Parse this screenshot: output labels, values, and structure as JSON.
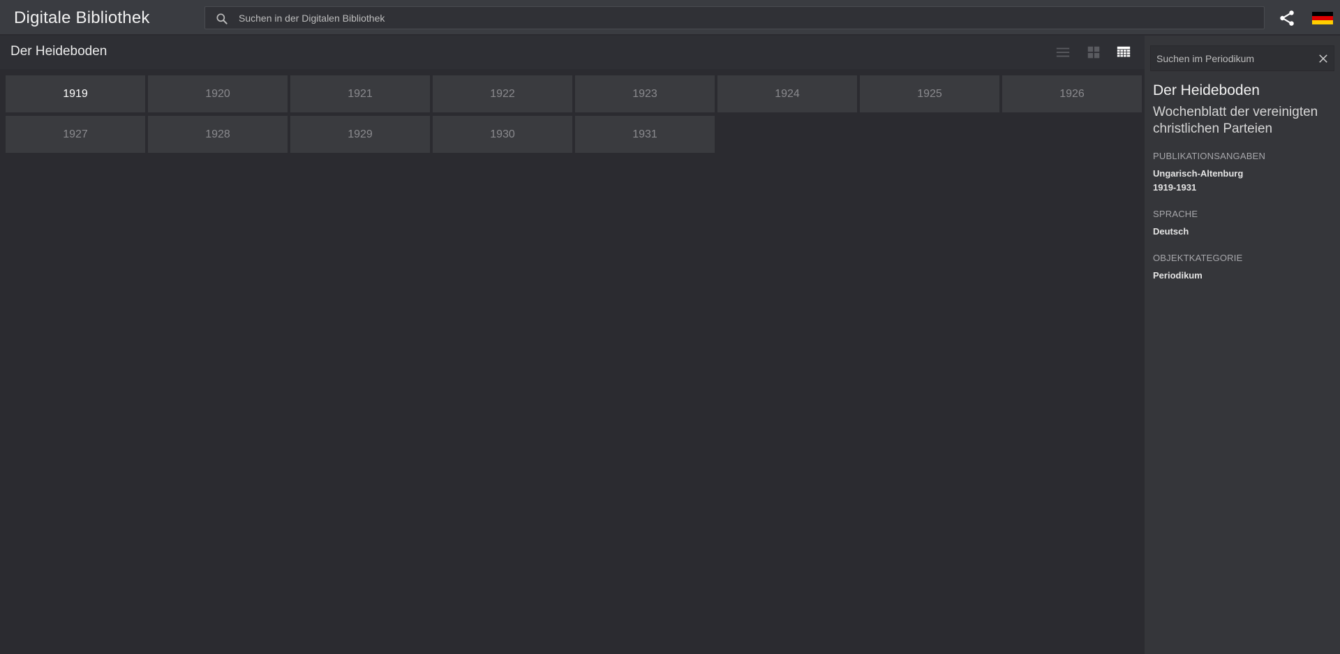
{
  "header": {
    "app_title": "Digitale Bibliothek",
    "search_placeholder": "Suchen in der Digitalen Bibliothek",
    "share_icon": "share-icon",
    "language_flag": "german-flag-icon",
    "flag_colors": [
      "#000000",
      "#dd0000",
      "#ffce00"
    ]
  },
  "main": {
    "title": "Der Heideboden",
    "view_modes": [
      "list-view-icon",
      "tile-view-icon",
      "grid-view-icon"
    ],
    "active_view": "grid-view-icon",
    "years": [
      "1919",
      "1920",
      "1921",
      "1922",
      "1923",
      "1924",
      "1925",
      "1926",
      "1927",
      "1928",
      "1929",
      "1930",
      "1931"
    ],
    "active_year": "1919"
  },
  "sidebar": {
    "search_placeholder": "Suchen im Periodikum",
    "title": "Der Heideboden",
    "subtitle": "Wochenblatt der vereinigten christlichen Parteien",
    "publication_label": "Publikationsangaben",
    "publication_place": "Ungarisch-Altenburg",
    "publication_years": "1919-1931",
    "language_label": "Sprache",
    "language_value": "Deutsch",
    "category_label": "Objektkategorie",
    "category_value": "Periodikum"
  }
}
